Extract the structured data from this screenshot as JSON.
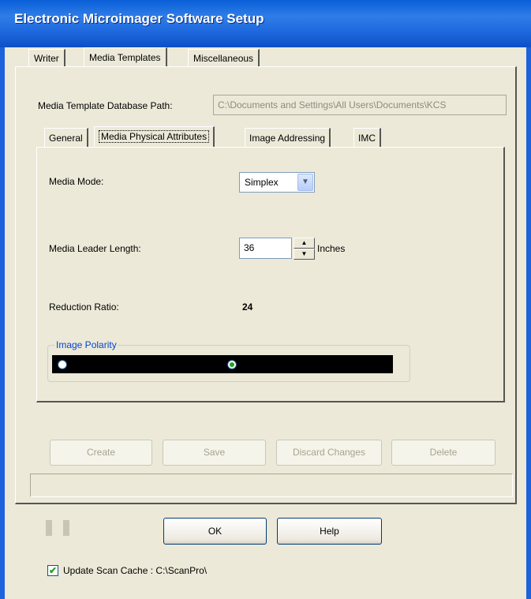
{
  "window": {
    "title": "Electronic Microimager Software Setup"
  },
  "outer_tabs": [
    {
      "label": "Writer",
      "selected": false
    },
    {
      "label": "Media Templates",
      "selected": true
    },
    {
      "label": "Miscellaneous",
      "selected": false
    }
  ],
  "database_path": {
    "label": "Media Template Database Path:",
    "value": "C:\\Documents and Settings\\All Users\\Documents\\KCS"
  },
  "inner_tabs": [
    {
      "label": "General",
      "selected": false
    },
    {
      "label": "Media Physical Attributes",
      "selected": true
    },
    {
      "label": "Image Addressing",
      "selected": false
    },
    {
      "label": "IMC",
      "selected": false
    }
  ],
  "media_mode": {
    "label": "Media Mode:",
    "value": "Simplex"
  },
  "leader_length": {
    "label": "Media Leader Length:",
    "value": "36",
    "unit": "Inches"
  },
  "reduction_ratio": {
    "label": "Reduction Ratio:",
    "value": "24"
  },
  "image_polarity": {
    "legend": "Image Polarity",
    "selected_option": 2
  },
  "template_buttons": {
    "create": "Create",
    "save": "Save",
    "discard": "Discard Changes",
    "delete": "Delete"
  },
  "dialog_buttons": {
    "ok": "OK",
    "help": "Help"
  },
  "scan_cache": {
    "label": "Update Scan Cache :  C:\\ScanPro\\",
    "checked": true
  },
  "colors": {
    "title_bar": "#1c66dc",
    "dialog_bg": "#ece9d8",
    "group_legend": "#0046d5",
    "disabled_text": "#a6a38f"
  }
}
